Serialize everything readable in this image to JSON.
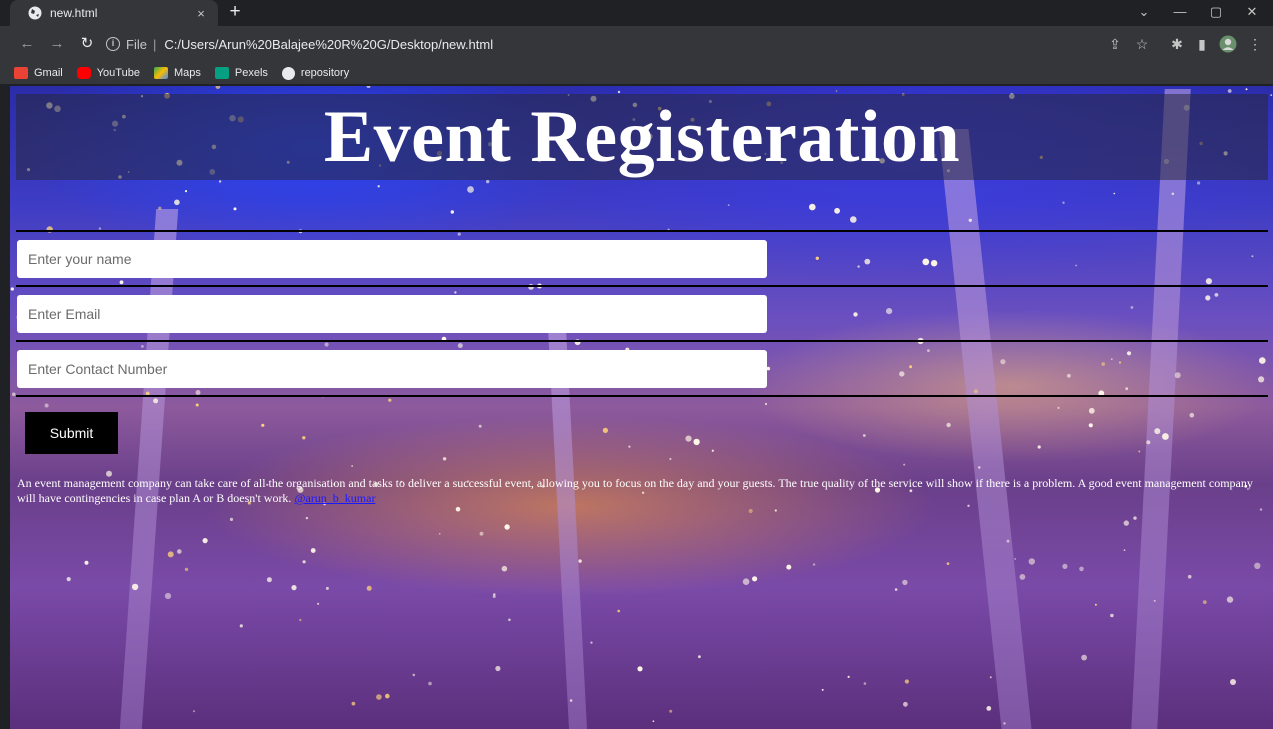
{
  "browser": {
    "tab_title": "new.html",
    "tab_close": "×",
    "new_tab": "+",
    "url_scheme": "File",
    "url_path": "C:/Users/Arun%20Balajee%20R%20G/Desktop/new.html",
    "bookmarks": [
      {
        "label": "Gmail",
        "color": "#ea4335"
      },
      {
        "label": "YouTube",
        "color": "#ff0000"
      },
      {
        "label": "Maps",
        "color": "#34a853"
      },
      {
        "label": "Pexels",
        "color": "#05a081"
      },
      {
        "label": "repository",
        "color": "#e8eaed"
      }
    ]
  },
  "page": {
    "title": "Event Registeration",
    "form": {
      "name_placeholder": "Enter your name",
      "email_placeholder": "Enter Email",
      "contact_placeholder": "Enter Contact Number",
      "submit_label": "Submit"
    },
    "description": "An event management company can take care of all the organisation and tasks to deliver a successful event, allowing you to focus on the day and your guests. The true quality of the service will show if there is a problem. A good event management company will have contingencies in case plan A or B doesn't work. ",
    "link_text": "@arun_b_kumar"
  }
}
